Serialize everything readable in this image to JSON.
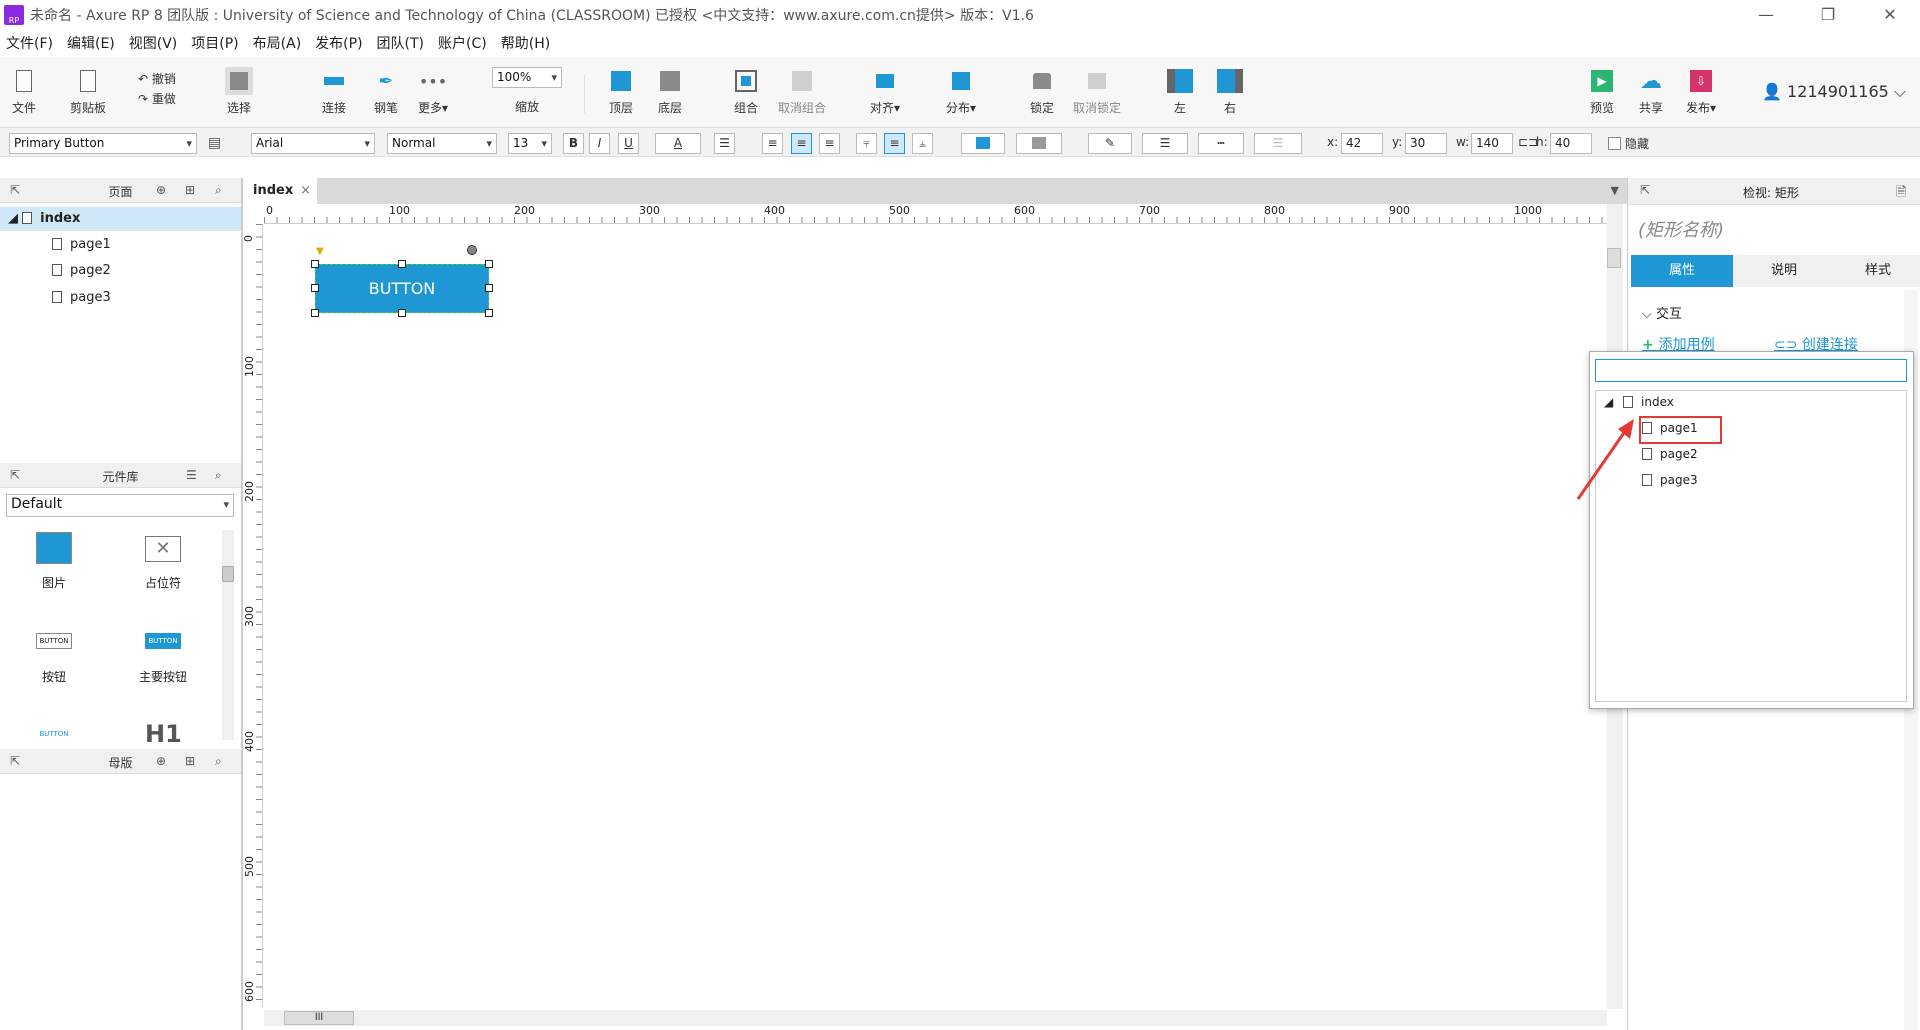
{
  "window": {
    "title": "未命名 - Axure RP 8 团队版 : University of Science and Technology of China (CLASSROOM) 已授权     <中文支持：www.axure.com.cn提供> 版本：V1.6",
    "logo_text": "RP"
  },
  "menubar": [
    "文件(F)",
    "编辑(E)",
    "视图(V)",
    "项目(P)",
    "布局(A)",
    "发布(P)",
    "团队(T)",
    "账户(C)",
    "帮助(H)"
  ],
  "toolbar": {
    "file": "文件",
    "clipboard": "剪贴板",
    "undo": "撤销",
    "redo": "重做",
    "select": "选择",
    "connect": "连接",
    "pen": "钢笔",
    "more": "更多▾",
    "zoom_value": "100%",
    "zoom_label": "缩放",
    "top_layer": "顶层",
    "bottom_layer": "底层",
    "group": "组合",
    "ungroup": "取消组合",
    "align": "对齐▾",
    "distribute": "分布▾",
    "lock": "锁定",
    "unlock": "取消锁定",
    "left": "左",
    "right": "右",
    "preview": "预览",
    "share": "共享",
    "publish": "发布▾",
    "user": "1214901165"
  },
  "formatbar": {
    "style": "Primary Button",
    "font": "Arial",
    "weight": "Normal",
    "size": "13",
    "bold": "B",
    "italic": "I",
    "underline": "U",
    "font_color": "A",
    "x_label": "x:",
    "x": "42",
    "y_label": "y:",
    "y": "30",
    "w_label": "w:",
    "w": "140",
    "h_label": "h:",
    "h": "40",
    "hidden": "隐藏"
  },
  "pages_panel": {
    "title": "页面",
    "root": "index",
    "children": [
      "page1",
      "page2",
      "page3"
    ]
  },
  "library_panel": {
    "title": "元件库",
    "selected": "Default",
    "items": [
      "图片",
      "占位符",
      "按钮",
      "主要按钮"
    ],
    "item_button_text": "BUTTON",
    "h1_text": "H1"
  },
  "masters_panel": {
    "title": "母版"
  },
  "canvas": {
    "tab": "index",
    "button_text": "BUTTON",
    "hruler": [
      "0",
      "100",
      "200",
      "300",
      "400",
      "500",
      "600",
      "700",
      "800",
      "900",
      "1000"
    ],
    "vruler": [
      "0",
      "100",
      "200",
      "300",
      "400",
      "500",
      "600"
    ]
  },
  "inspector": {
    "title": "检视: 矩形",
    "name_placeholder": "(矩形名称)",
    "tabs": [
      "属性",
      "说明",
      "样式"
    ],
    "section": "交互",
    "add_case": "添加用例",
    "create_link": "创建连接"
  },
  "link_popup": {
    "root": "index",
    "children": [
      "page1",
      "page2",
      "page3"
    ],
    "highlighted": "page1"
  },
  "colors": {
    "accent": "#1f97d4",
    "highlight": "#e53935"
  }
}
